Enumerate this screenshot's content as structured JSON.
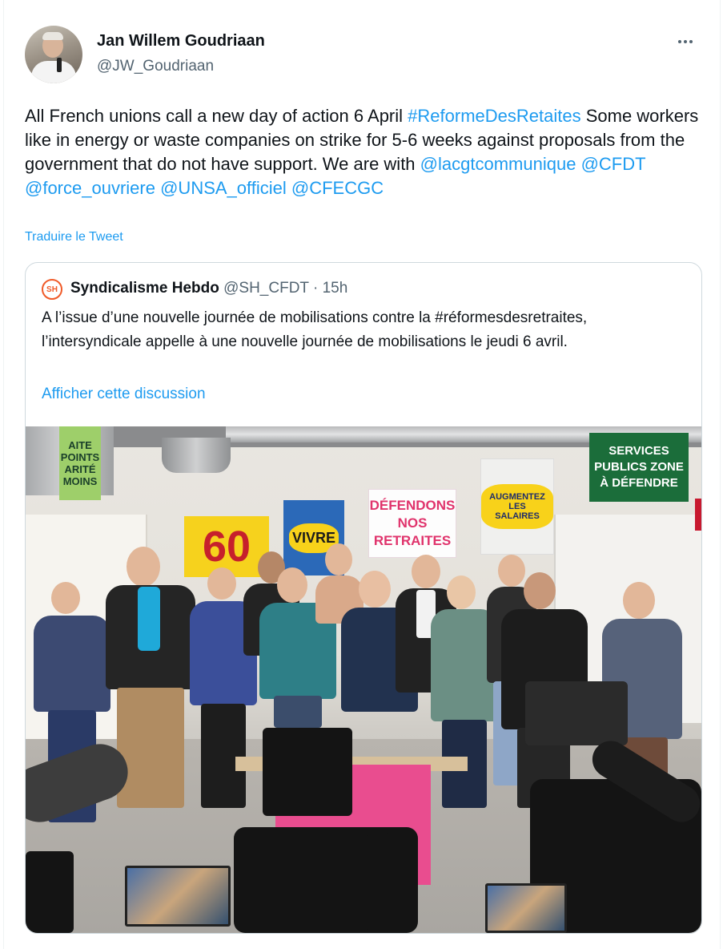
{
  "tweet": {
    "author_name": "Jan Willem Goudriaan",
    "author_handle": "@JW_Goudriaan",
    "text_plain_1": "All French unions call a new day of action 6 April ",
    "hashtag": "#ReformeDesRetaites",
    "text_plain_2": " Some workers like in energy or waste companies on strike for 5-6 weeks against proposals from the government that do not have support. We are with ",
    "mentions": [
      "@lacgtcommunique",
      "@CFDT",
      "@force_ouvriere",
      "@UNSA_officiel",
      "@CFECGC"
    ],
    "translate_label": "Traduire le Tweet",
    "more_icon": "more-horizontal-icon"
  },
  "quote": {
    "logo_text": "SH",
    "author_name": "Syndicalisme Hebdo",
    "author_handle": "@SH_CFDT",
    "separator": "·",
    "time": "15h",
    "text": "A l’issue d’une nouvelle journée de mobilisations contre la #réformesdesretraites, l’intersyndicale appelle à une nouvelle journée de mobilisations le jeudi 6 avril.",
    "show_thread_label": "Afficher cette discussion"
  },
  "photo_posters": {
    "aite": "AITE POINTS ARITÉ MOINS",
    "sixty": "60",
    "vivre": "VIVRE",
    "defendons": "DÉFENDONS NOS RETRAITES",
    "salaires": "AUGMENTEZ LES SALAIRES",
    "services": "SERVICES PUBLICS ZONE À DÉFENDRE"
  },
  "colors": {
    "link": "#1d9bf0",
    "text": "#0f1419",
    "secondary": "#536471",
    "border": "#cfd9de"
  }
}
